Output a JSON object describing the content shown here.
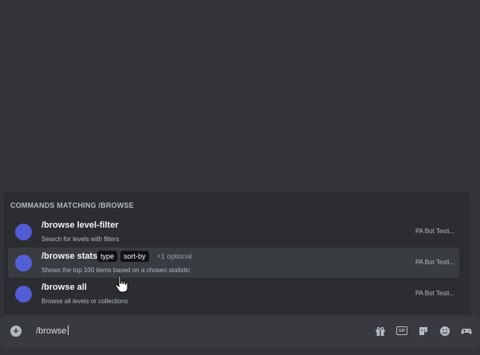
{
  "autocomplete": {
    "header": "COMMANDS MATCHING /BROWSE",
    "commands": [
      {
        "name": "/browse level-filter",
        "description": "Search for levels with filters",
        "source": "PA Bot Testi..."
      },
      {
        "name": "/browse stats",
        "options": [
          "type",
          "sort-by"
        ],
        "extra": "+1 optional",
        "description": "Shows the top 100 items based on a chosen statistic",
        "source": "PA Bot Testi..."
      },
      {
        "name": "/browse all",
        "description": "Browse all levels or collections",
        "source": "PA Bot Testi..."
      }
    ]
  },
  "composer": {
    "value": "/browse",
    "icons": [
      "add-icon",
      "gift-icon",
      "gif-icon",
      "sticker-icon",
      "emoji-icon",
      "activities-icon"
    ]
  },
  "colors": {
    "background": "#313338",
    "popup": "#2b2d31",
    "selected_row": "#393c41",
    "avatar": "#5865f2",
    "input": "#383a40"
  }
}
